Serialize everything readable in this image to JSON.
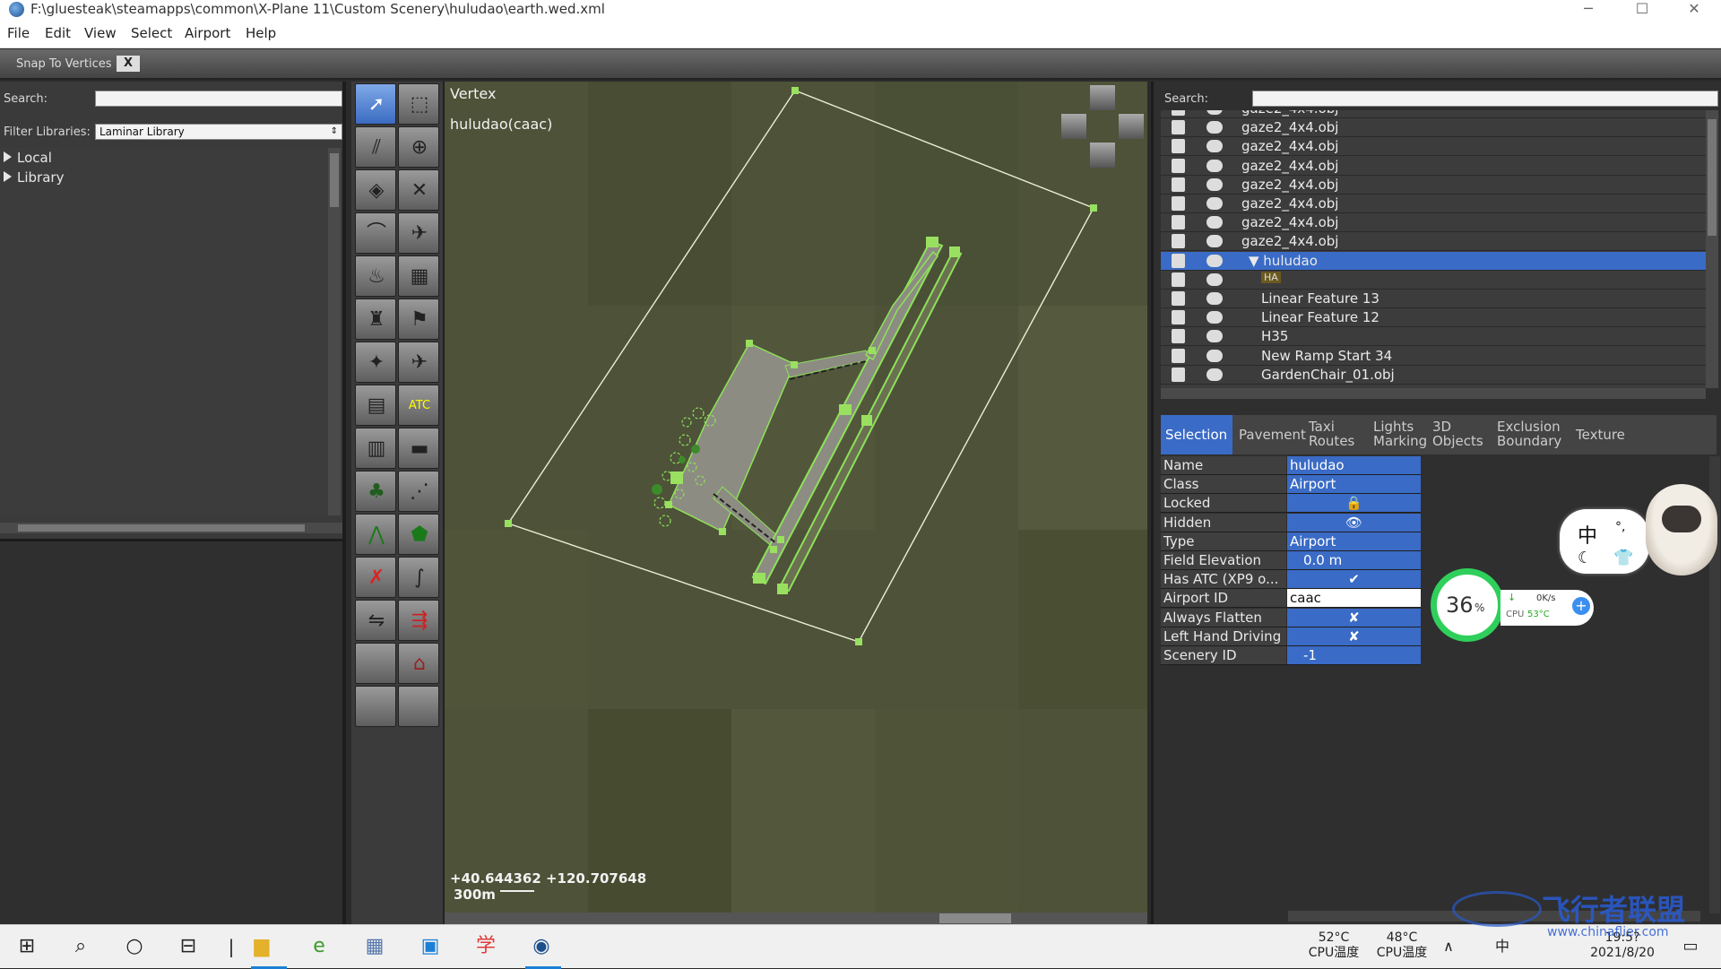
{
  "window": {
    "title": "F:\\gluesteak\\steamapps\\common\\X-Plane 11\\Custom Scenery\\huludao\\earth.wed.xml",
    "minimize": "─",
    "maximize": "☐",
    "close": "✕"
  },
  "menu": {
    "items": [
      "File",
      "Edit",
      "View",
      "Select",
      "Airport",
      "Help"
    ]
  },
  "snap": {
    "label": "Snap To Vertices",
    "value": "X"
  },
  "library": {
    "search_label": "Search:",
    "search_value": "",
    "filter_label": "Filter Libraries:",
    "filter_value": "Laminar Library",
    "tree": [
      "Local",
      "Library"
    ]
  },
  "tools": {
    "atc_label": "ATC"
  },
  "map": {
    "mode_label": "Vertex",
    "airport_label": "huludao(caac)",
    "coordinates": "+40.644362 +120.707648",
    "scale_label": "300m"
  },
  "hierarchy": {
    "search_label": "Search:",
    "rows": [
      {
        "label": "gaze2_4x4.obj",
        "indent": 0,
        "selected": false
      },
      {
        "label": "gaze2_4x4.obj",
        "indent": 0,
        "selected": false
      },
      {
        "label": "gaze2_4x4.obj",
        "indent": 0,
        "selected": false
      },
      {
        "label": "gaze2_4x4.obj",
        "indent": 0,
        "selected": false
      },
      {
        "label": "gaze2_4x4.obj",
        "indent": 0,
        "selected": false
      },
      {
        "label": "gaze2_4x4.obj",
        "indent": 0,
        "selected": false
      },
      {
        "label": "gaze2_4x4.obj",
        "indent": 0,
        "selected": false
      },
      {
        "label": "gaze2_4x4.obj",
        "indent": 0,
        "selected": false
      },
      {
        "label": "▼ huludao",
        "indent": 1,
        "selected": true
      },
      {
        "label": "HA",
        "indent": 2,
        "selected": false
      },
      {
        "label": "Linear Feature 13",
        "indent": 2,
        "selected": false
      },
      {
        "label": "Linear Feature 12",
        "indent": 2,
        "selected": false
      },
      {
        "label": "H35",
        "indent": 2,
        "selected": false
      },
      {
        "label": "New Ramp Start 34",
        "indent": 2,
        "selected": false
      },
      {
        "label": "GardenChair_01.obj",
        "indent": 2,
        "selected": false
      }
    ]
  },
  "tabs": [
    {
      "label": "Selection",
      "active": true
    },
    {
      "label": "Pavement",
      "active": false
    },
    {
      "label": "Taxi Routes",
      "active": false
    },
    {
      "label": "Lights Marking",
      "active": false
    },
    {
      "label": "3D Objects",
      "active": false
    },
    {
      "label": "Exclusion Boundary",
      "active": false
    },
    {
      "label": "Texture",
      "active": false
    }
  ],
  "properties": [
    {
      "key": "Name",
      "value": "huludao"
    },
    {
      "key": "Class",
      "value": "Airport"
    },
    {
      "key": "Locked",
      "value": "🔒"
    },
    {
      "key": "Hidden",
      "value": "👁"
    },
    {
      "key": "Type",
      "value": "Airport"
    },
    {
      "key": "Field Elevation",
      "value": "0.0 m"
    },
    {
      "key": "Has ATC (XP9 o...",
      "value": "✔"
    },
    {
      "key": "Airport ID",
      "value": "caac"
    },
    {
      "key": "Always Flatten",
      "value": "✘"
    },
    {
      "key": "Left Hand Driving",
      "value": "✘"
    },
    {
      "key": "Scenery ID",
      "value": "-1"
    }
  ],
  "cpu_widget": {
    "percent": "36",
    "percent_unit": "%",
    "net": "0K/s",
    "cpu_label": "CPU",
    "cpu_temp": "53°C"
  },
  "mascot": {
    "ime_char": "中",
    "dot": "°,"
  },
  "taskbar": {
    "temp1": "52°C",
    "temp1_label": "CPU温度",
    "temp2": "48°C",
    "temp2_label": "CPU温度",
    "time": "19:5?",
    "date": "2021/8/20",
    "ime": "中",
    "watermark_cn": "飞行者联盟",
    "watermark_url": "www.chinaflier.com"
  },
  "colors": {
    "accent": "#3a6bc6",
    "map_bg": "#4c5136",
    "pavement": "#8d8c82",
    "green_line": "#8ee25a"
  }
}
